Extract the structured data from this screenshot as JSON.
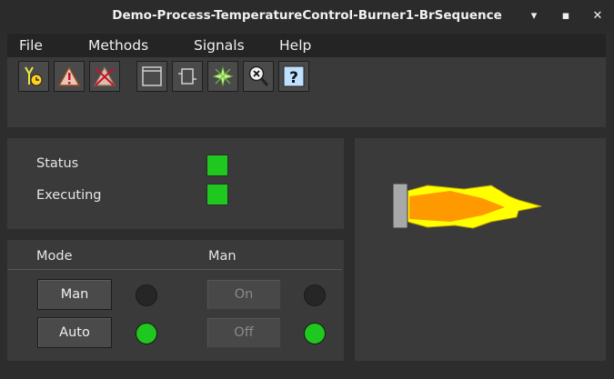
{
  "window": {
    "title": "Demo-Process-TemperatureControl-Burner1-BrSequence",
    "minimize_glyph": "▾",
    "maximize_glyph": "▪",
    "close_glyph": "✕"
  },
  "menu": {
    "items": [
      {
        "label": "File"
      },
      {
        "label": "Methods"
      },
      {
        "label": "Signals"
      },
      {
        "label": "Help"
      }
    ]
  },
  "toolbar": {
    "icons": [
      "trend-icon",
      "warning-icon",
      "blocked-icon",
      "window-icon",
      "object-icon",
      "flash-icon",
      "crossref-icon",
      "help-icon"
    ],
    "help_glyph": "?"
  },
  "status_panel": {
    "status_label": "Status",
    "executing_label": "Executing",
    "status_color": "#1ec81e",
    "executing_color": "#1ec81e"
  },
  "mode_panel": {
    "mode_header": "Mode",
    "man_header": "Man",
    "man_button": "Man",
    "auto_button": "Auto",
    "on_button": "On",
    "off_button": "Off",
    "man_led": "off",
    "auto_led": "on",
    "on_led": "off",
    "off_led": "on"
  },
  "burner": {
    "flame_colors": [
      "#ffff00",
      "#ff9900"
    ],
    "nozzle_color": "#a8a8a8"
  }
}
